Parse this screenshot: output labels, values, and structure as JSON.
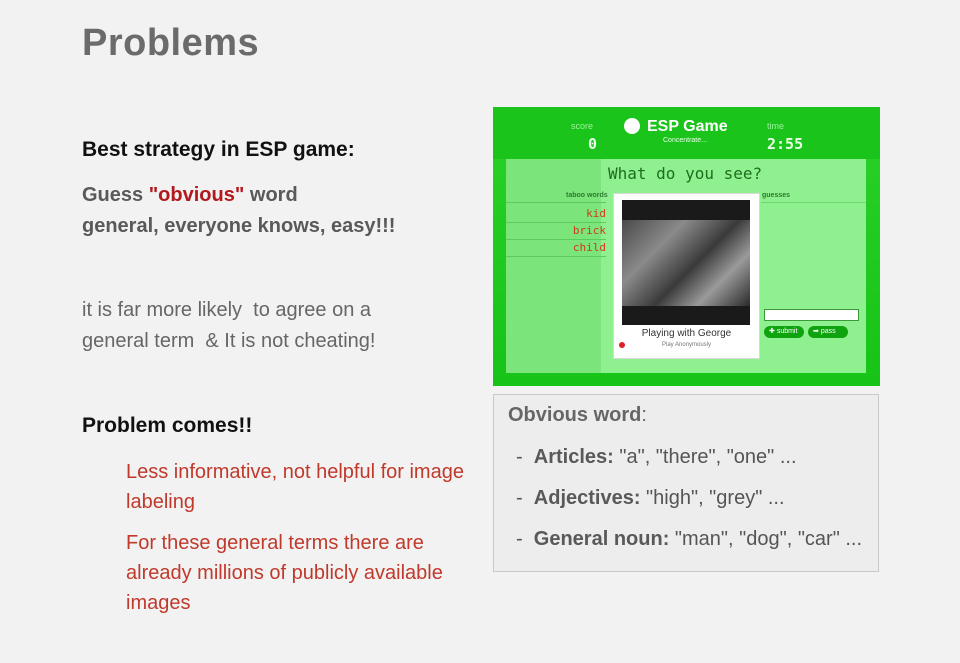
{
  "slide": {
    "title": "Problems",
    "best_strategy": "Best strategy in ESP game:",
    "guess_prefix": "Guess ",
    "guess_highlight": "\"obvious\"",
    "guess_suffix": " word",
    "guess_line2": "general, everyone knows, easy!!!",
    "likely_line1": "it is far more likely  to agree on a",
    "likely_line2": "general term  & It is not cheating!",
    "problem_heading": "Problem comes!!",
    "problem_points": [
      "Less informative, not helpful for image labeling",
      "For these general terms there are already millions of publicly available images"
    ]
  },
  "esp_screenshot": {
    "score_label": "score",
    "score_value": "0",
    "logo_text": "ESP Game",
    "logo_sub": "Concentrate...",
    "time_label": "time",
    "time_value": "2:55",
    "question": "What do you see?",
    "taboo_label": "taboo words",
    "taboo_words": [
      "kid",
      "brick",
      "child"
    ],
    "guesses_label": "guesses",
    "caption": "Playing with George",
    "caption_sub": "Play Anonymously",
    "submit_label": "submit",
    "pass_label": "pass",
    "colors": {
      "bg": "#22cc22",
      "taboo": "#d13a1a"
    }
  },
  "obvious_box": {
    "title": "Obvious word",
    "title_colon": ":",
    "items": [
      {
        "label": "Articles:",
        "examples": " \"a\", \"there\", \"one\" ..."
      },
      {
        "label": "Adjectives:",
        "examples": " \"high\", \"grey\" ..."
      },
      {
        "label": "General noun:",
        "examples": " \"man\", \"dog\", \"car\" ..."
      }
    ]
  }
}
